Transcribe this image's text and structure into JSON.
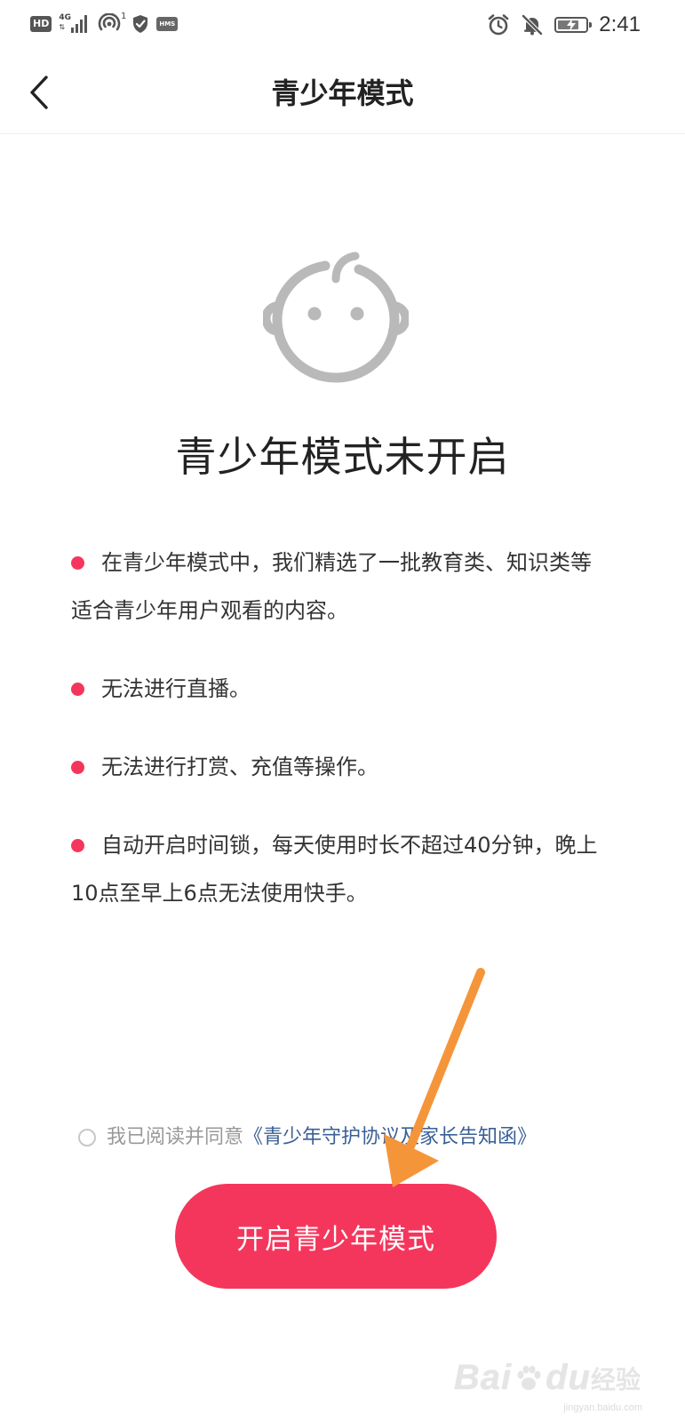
{
  "status_bar": {
    "hd_label": "HD",
    "network_label": "4G",
    "hotspot_count": "1",
    "hms_label": "HMS",
    "time": "2:41",
    "icons": [
      "signal-icon",
      "hotspot-icon",
      "shield-icon",
      "alarm-icon",
      "mute-bell-icon",
      "battery-icon"
    ],
    "battery_level": 0.75
  },
  "header": {
    "title": "青少年模式"
  },
  "main": {
    "illustration_icon": "baby-face-icon",
    "status_heading": "青少年模式未开启",
    "bullets": [
      "在青少年模式中，我们精选了一批教育类、知识类等适合青少年用户观看的内容。",
      "无法进行直播。",
      "无法进行打赏、充值等操作。",
      "自动开启时间锁，每天使用时长不超过40分钟，晚上10点至早上6点无法使用快手。"
    ],
    "bullet_color": "#f5365c"
  },
  "agreement": {
    "checked": false,
    "text": "我已阅读并同意",
    "link": "《青少年守护协议及家长告知函》"
  },
  "enable_button": {
    "label": "开启青少年模式",
    "color": "#f5365c"
  },
  "annotation": {
    "arrow_color": "#f5953a"
  },
  "watermark": {
    "brand": "Bai",
    "brand_suffix": "du",
    "product": "经验",
    "url": "jingyan.baidu.com"
  }
}
